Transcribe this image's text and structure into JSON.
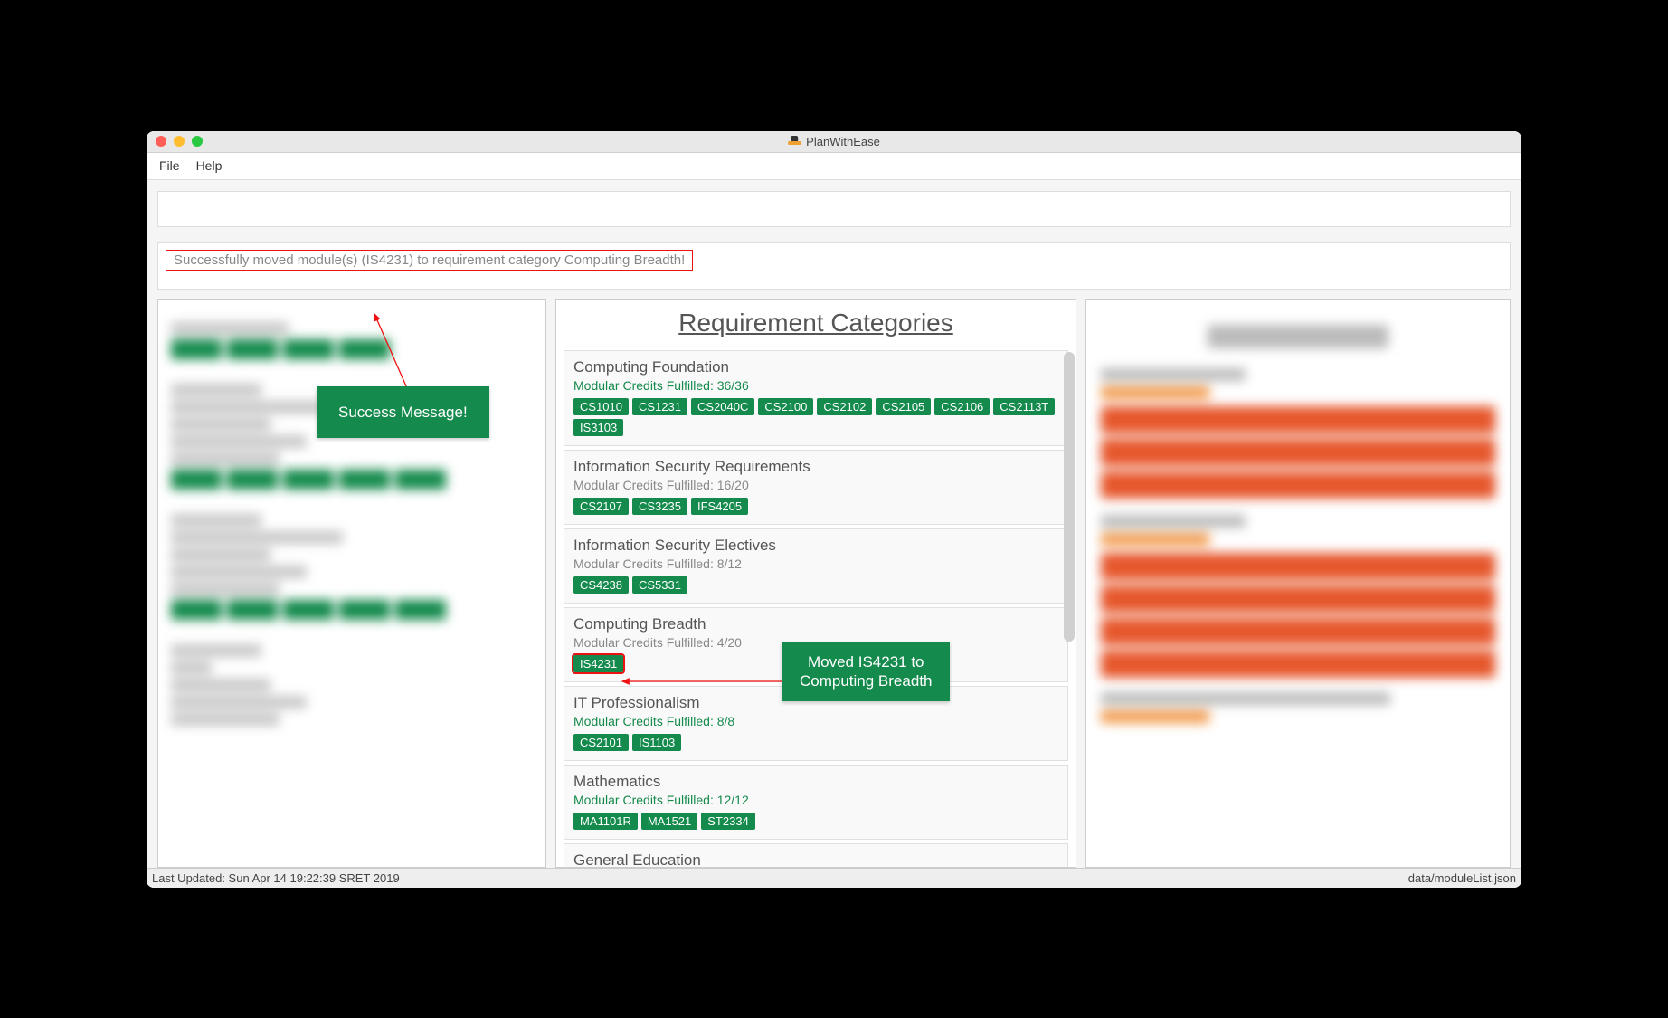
{
  "window": {
    "title": "PlanWithEase"
  },
  "menu": {
    "file": "File",
    "help": "Help"
  },
  "status_message": "Successfully moved module(s) (IS4231) to requirement category Computing Breadth!",
  "callouts": {
    "success": "Success Message!",
    "moved_line1": "Moved IS4231 to",
    "moved_line2": "Computing Breadth"
  },
  "mid": {
    "title": "Requirement Categories",
    "categories": [
      {
        "name": "Computing Foundation",
        "credits": "Modular Credits Fulfilled: 36/36",
        "full": true,
        "tags": [
          "CS1010",
          "CS1231",
          "CS2040C",
          "CS2100",
          "CS2102",
          "CS2105",
          "CS2106",
          "CS2113T",
          "IS3103"
        ]
      },
      {
        "name": "Information Security Requirements",
        "credits": "Modular Credits Fulfilled: 16/20",
        "full": false,
        "tags": [
          "CS2107",
          "CS3235",
          "IFS4205"
        ]
      },
      {
        "name": "Information Security Electives",
        "credits": "Modular Credits Fulfilled: 8/12",
        "full": false,
        "tags": [
          "CS4238",
          "CS5331"
        ]
      },
      {
        "name": "Computing Breadth",
        "credits": "Modular Credits Fulfilled: 4/20",
        "full": false,
        "tags": [
          "IS4231"
        ],
        "highlight_tag": "IS4231"
      },
      {
        "name": "IT Professionalism",
        "credits": "Modular Credits Fulfilled: 8/8",
        "full": true,
        "tags": [
          "CS2101",
          "IS1103"
        ]
      },
      {
        "name": "Mathematics",
        "credits": "Modular Credits Fulfilled: 12/12",
        "full": true,
        "tags": [
          "MA1101R",
          "MA1521",
          "ST2334"
        ]
      },
      {
        "name": "General Education",
        "credits": "",
        "full": false,
        "tags": []
      }
    ]
  },
  "footer": {
    "left": "Last Updated: Sun Apr 14 19:22:39 SRET 2019",
    "right": "data/moduleList.json"
  }
}
